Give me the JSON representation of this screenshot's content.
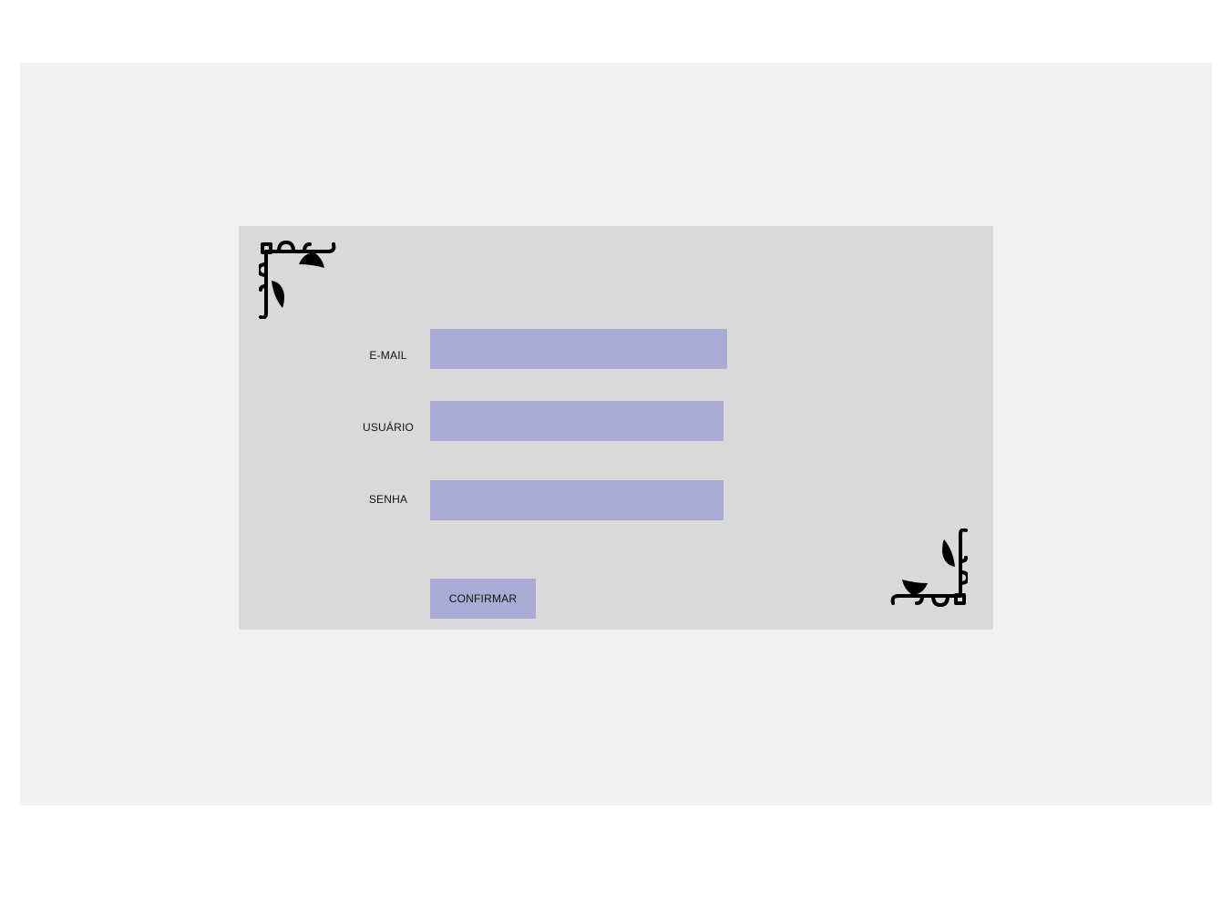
{
  "form": {
    "email_label": "E-MAIL",
    "email_value": "",
    "username_label": "USUÁRIO",
    "username_value": "",
    "password_label": "SENHA",
    "password_value": "",
    "confirm_label": "CONFIRMAR"
  },
  "icons": {
    "top_left": "corner-ornament-icon",
    "bottom_right": "corner-ornament-icon"
  },
  "colors": {
    "page_background": "#ffffff",
    "backdrop": "#f1f1f1",
    "card": "#d9d9d9",
    "accent": "#a9abd4",
    "ornament": "#000000"
  }
}
